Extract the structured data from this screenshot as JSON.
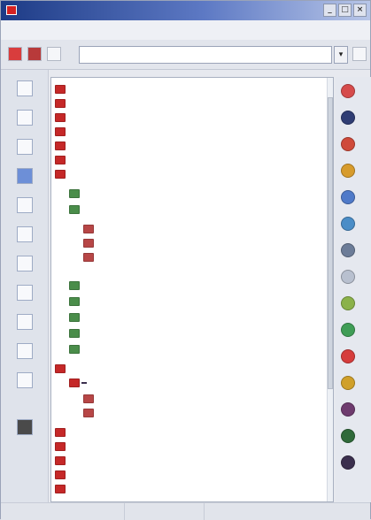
{
  "window": {
    "title": "",
    "controls": [
      "_",
      "□",
      "×"
    ]
  },
  "menu": {
    "items": [
      "",
      "",
      "",
      ""
    ]
  },
  "toolbar": {
    "path_value": "",
    "dropdown_symbol": "▾"
  },
  "tree": {
    "rows": [
      {
        "label": "",
        "icon_color": "#c52828"
      },
      {
        "label": "",
        "icon_color": "#c52828"
      },
      {
        "label": "",
        "icon_color": "#c52828"
      },
      {
        "label": "",
        "icon_color": "#c52828"
      },
      {
        "label": "",
        "icon_color": "#c52828"
      },
      {
        "label": "",
        "icon_color": "#c52828"
      },
      {
        "label": "",
        "icon_color": "#c52828"
      },
      {
        "label": "",
        "icon_color": "#4a8d4a"
      },
      {
        "label": "",
        "icon_color": "#4a8d4a"
      },
      {
        "label": "",
        "icon_color": "#b74646"
      },
      {
        "label": "",
        "icon_color": "#b74646"
      },
      {
        "label": "",
        "icon_color": "#b74646"
      },
      {
        "label": "",
        "icon_color": "#4a8d4a"
      },
      {
        "label": "",
        "icon_color": "#4a8d4a"
      },
      {
        "label": "",
        "icon_color": "#4a8d4a"
      },
      {
        "label": "",
        "icon_color": "#4a8d4a"
      },
      {
        "label": "",
        "icon_color": "#4a8d4a"
      },
      {
        "label": "",
        "icon_color": "#c52828"
      },
      {
        "label": "",
        "icon_color": "#c52828",
        "selected": true
      },
      {
        "label": "",
        "icon_color": "#b74646"
      },
      {
        "label": "",
        "icon_color": "#b74646"
      },
      {
        "label": "",
        "icon_color": "#c52828"
      },
      {
        "label": "",
        "icon_color": "#c52828"
      },
      {
        "label": "",
        "icon_color": "#c52828"
      },
      {
        "label": "",
        "icon_color": "#c52828"
      },
      {
        "label": "",
        "icon_color": "#c52828"
      }
    ]
  },
  "status": {
    "segments": [
      "",
      "",
      ""
    ]
  },
  "colors": {
    "title_start": "#1d3b86",
    "title_end": "#b8c6e8",
    "selection": "#3b2f4e",
    "tree_background": "#ffffff"
  },
  "icons": {
    "left_strip": [
      "folder-icon",
      "file-icon",
      "list-icon",
      "database-icon",
      "table-icon",
      "image-icon",
      "chart-icon",
      "settings-icon",
      "report-icon",
      "map-icon",
      "grid-icon",
      "camera-icon"
    ],
    "right_strip": [
      "pencil-icon",
      "pointer-icon",
      "palette-icon",
      "shape-icon",
      "link-icon",
      "globe-icon",
      "lock-icon",
      "brush-icon",
      "sparkle-icon",
      "drop-icon",
      "text-icon",
      "tag-icon",
      "layer-icon",
      "gear-icon",
      "star-icon"
    ]
  }
}
